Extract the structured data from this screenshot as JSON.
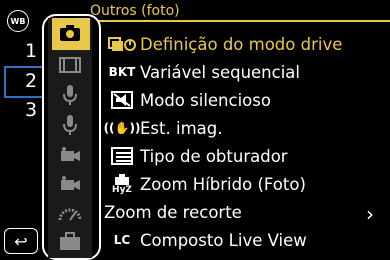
{
  "badge": {
    "label": "WB"
  },
  "header": {
    "title": "Outros (foto)"
  },
  "pages": [
    "1",
    "2",
    "3"
  ],
  "side_icons": [
    "camera-icon",
    "film-icon",
    "microphone-icon",
    "microphone-icon",
    "video-camera-icon",
    "video-camera-icon",
    "gauge-icon",
    "briefcase-icon"
  ],
  "items": [
    {
      "icon": "⧉",
      "label": "Definição do modo drive"
    },
    {
      "icon": "BKT",
      "label": "Variável sequencial"
    },
    {
      "icon": "◧",
      "label": "Modo silencioso"
    },
    {
      "icon": "((✋))",
      "label": "Est. imag."
    },
    {
      "icon": "☰",
      "label": "Tipo de obturador"
    },
    {
      "icon": "HyZ",
      "label": "Zoom Híbrido (Foto)"
    },
    {
      "icon": "",
      "label": "Zoom de recorte"
    },
    {
      "icon": "LC",
      "label": "Composto Live View"
    }
  ],
  "back": {
    "label": "↩"
  },
  "colors": {
    "accent": "#e8c84a",
    "page_line": "#2f6fbf"
  }
}
